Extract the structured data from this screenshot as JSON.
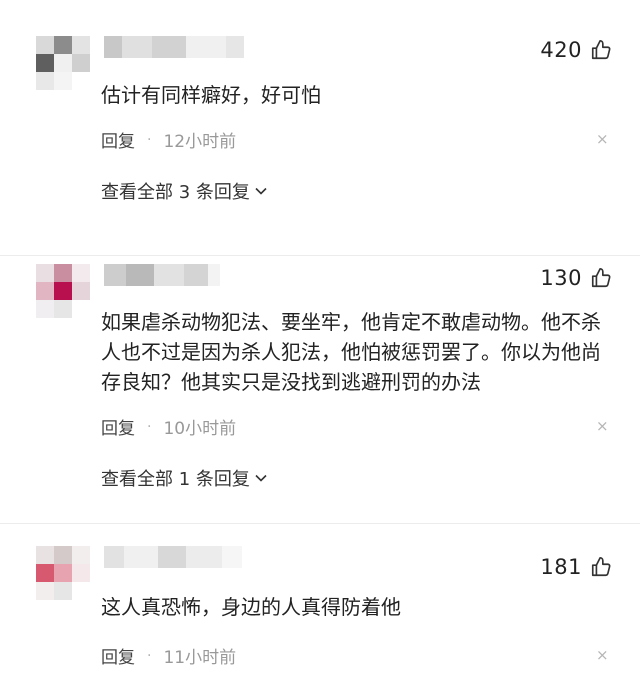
{
  "comments": [
    {
      "likes": "420",
      "text": "估计有同样癖好，好可怕",
      "reply_label": "回复",
      "dot": "·",
      "time": "12小时前",
      "close": "×",
      "view_replies": "查看全部 3 条回复",
      "avatar_colors": [
        "#d9d9d9",
        "#8c8c8c",
        "#e3e3e3",
        "#5f5f5f",
        "#f0f0f0",
        "#cfcfcf",
        "#e8e8e8",
        "#f4f4f4",
        "#ffffff"
      ],
      "name_colors": [
        "#c8c8c8",
        "#e0e0e0",
        "#d2d2d2",
        "#f0f0f0",
        "#e6e6e6"
      ]
    },
    {
      "likes": "130",
      "text": "如果虐杀动物犯法、要坐牢，他肯定不敢虐动物。他不杀人也不过是因为杀人犯法，他怕被惩罚罢了。你以为他尚存良知？他其实只是没找到逃避刑罚的办法",
      "reply_label": "回复",
      "dot": "·",
      "time": "10小时前",
      "close": "×",
      "view_replies": "查看全部 1 条回复",
      "avatar_colors": [
        "#e9dfe2",
        "#c98fa0",
        "#f2eaec",
        "#e2b5c2",
        "#b80f4f",
        "#e5d5da",
        "#f0eef0",
        "#e6e6e6",
        "#ffffff"
      ],
      "name_colors": [
        "#cdcdcd",
        "#b9b9b9",
        "#e2e2e2",
        "#d4d4d4",
        "#f3f3f3"
      ]
    },
    {
      "likes": "181",
      "text": "这人真恐怖，身边的人真得防着他",
      "reply_label": "回复",
      "dot": "·",
      "time": "11小时前",
      "close": "×",
      "avatar_colors": [
        "#e8e2e2",
        "#d4caca",
        "#f2eeee",
        "#d7596f",
        "#e7a3b0",
        "#f4e8ea",
        "#f2eeee",
        "#e6e6e6",
        "#ffffff"
      ],
      "name_colors": [
        "#e2e2e2",
        "#f0f0f0",
        "#d8d8d8",
        "#ececec",
        "#f6f6f6"
      ]
    }
  ],
  "icons": {
    "like": "thumbs-up-icon",
    "close": "close-icon",
    "expand": "chevron-down-icon"
  },
  "colors": {
    "text": "#222222",
    "meta": "#999999",
    "divider": "#ececec"
  }
}
